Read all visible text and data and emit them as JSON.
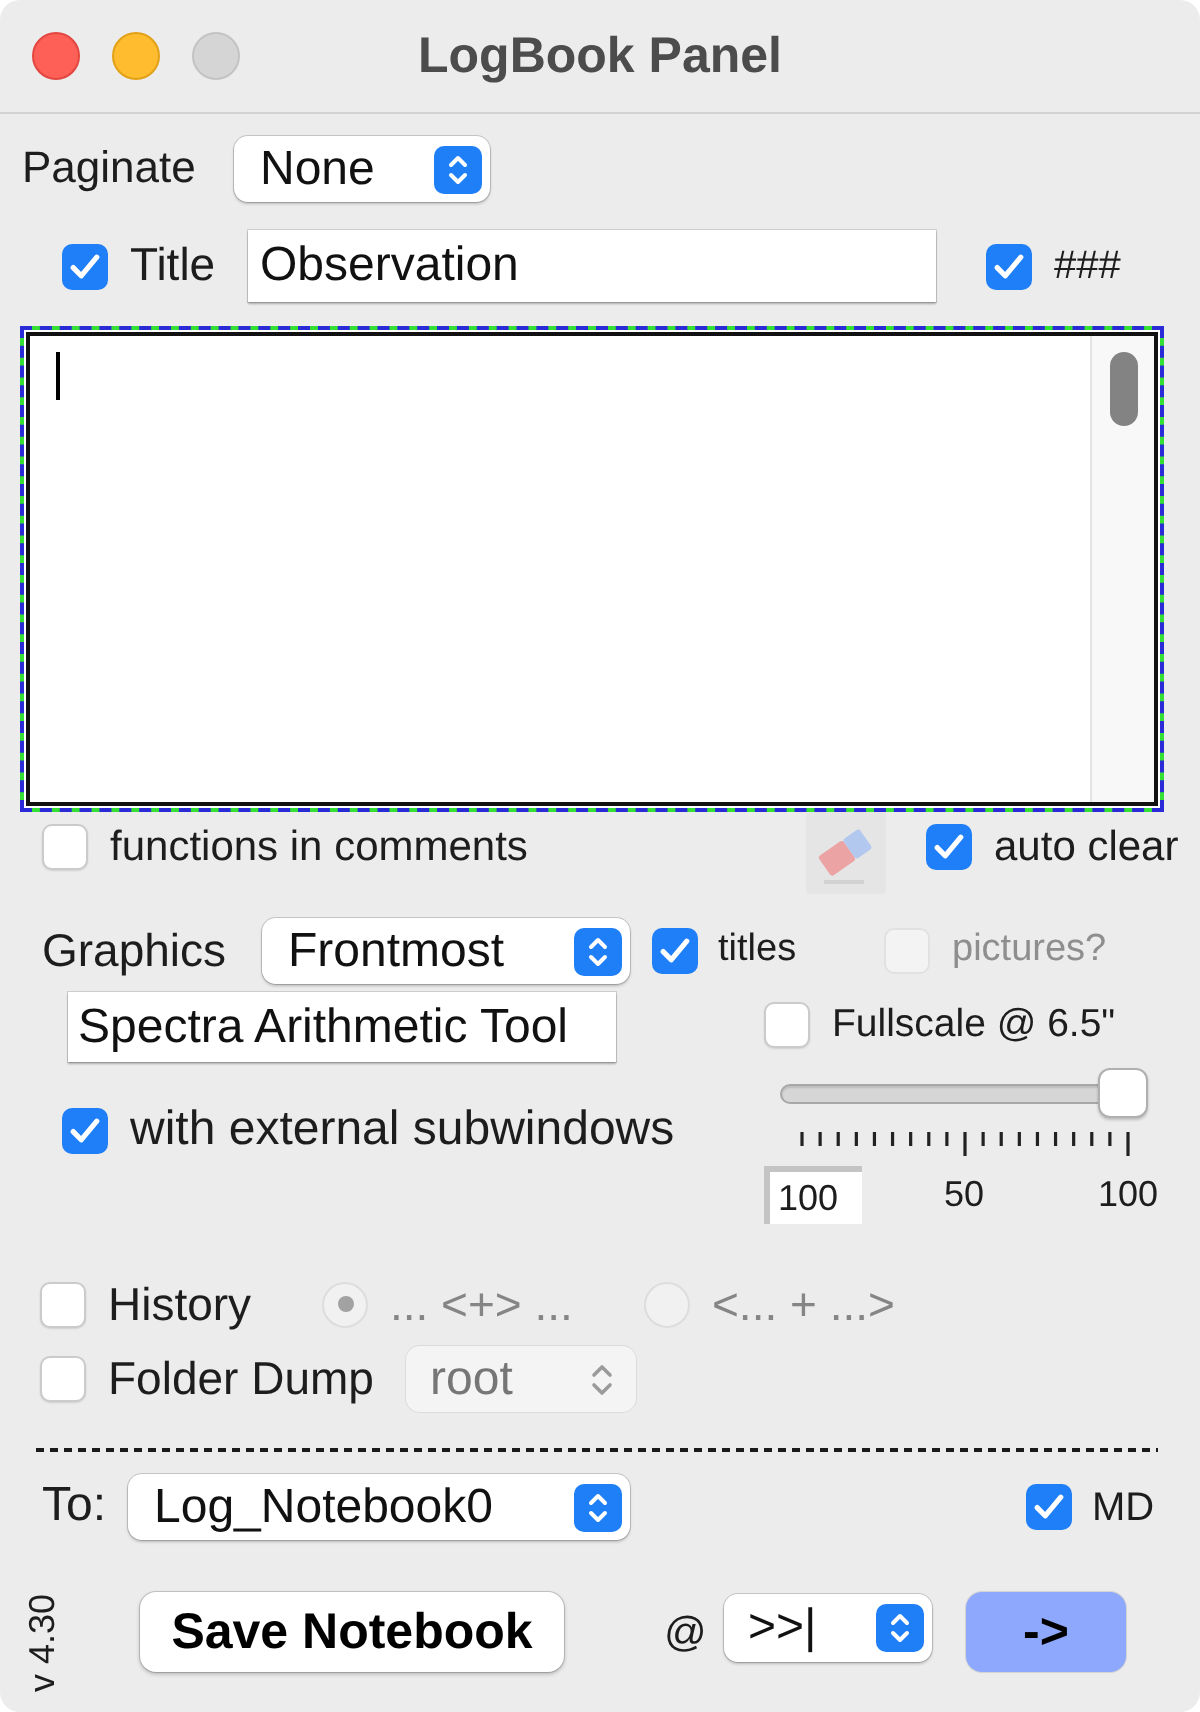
{
  "window": {
    "title": "LogBook Panel"
  },
  "paginate": {
    "label": "Paginate",
    "value": "None"
  },
  "title": {
    "checked": true,
    "label": "Title",
    "value": "Observation"
  },
  "numbering": {
    "checked": true,
    "label": "###"
  },
  "notes": {
    "focused": true
  },
  "functions_in_comments": {
    "checked": false,
    "label": "functions in comments"
  },
  "clear_button": {
    "disabled": true
  },
  "auto_clear": {
    "checked": true,
    "label": "auto clear"
  },
  "graphics": {
    "label": "Graphics",
    "value": "Frontmost"
  },
  "titles": {
    "checked": true,
    "label": "titles"
  },
  "pictures": {
    "checked": false,
    "disabled": true,
    "label": "pictures?"
  },
  "window_name": {
    "value": "Spectra Arithmetic Tool"
  },
  "fullscale": {
    "checked": false,
    "label": "Fullscale @ 6.5\""
  },
  "external_subwindows": {
    "checked": true,
    "label": "with external subwindows"
  },
  "scale_slider": {
    "level": 1,
    "value": "100",
    "tick_labels": [
      "50",
      "100"
    ]
  },
  "history": {
    "checked": false,
    "label": "History",
    "modes": [
      {
        "label": "... <+> ...",
        "selected": true,
        "disabled": true
      },
      {
        "label": "<... + ...>",
        "selected": false,
        "disabled": true
      }
    ]
  },
  "folder_dump": {
    "checked": false,
    "label": "Folder Dump",
    "value": "root",
    "disabled": true
  },
  "destination": {
    "label": "To:",
    "value": "Log_Notebook0"
  },
  "markdown": {
    "checked": true,
    "label": "MD"
  },
  "version": "v 4.30",
  "save_button": {
    "label": "Save Notebook"
  },
  "insert_at": {
    "label": "@",
    "value": ">>|"
  },
  "go_button": {
    "label": "->"
  }
}
